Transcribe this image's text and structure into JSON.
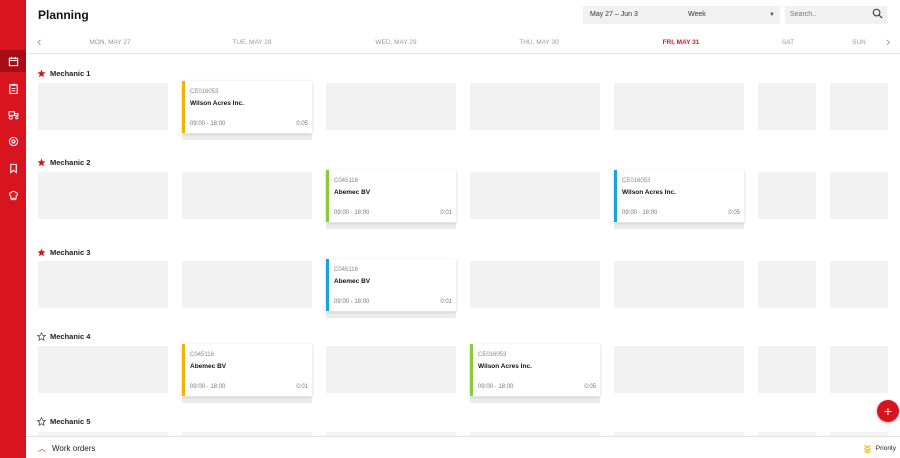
{
  "header": {
    "title": "Planning",
    "date_range": "May 27 – Jun 3",
    "view": "Week",
    "search_placeholder": "Search.."
  },
  "days": [
    {
      "label": "MON, MAY 27",
      "today": false
    },
    {
      "label": "TUE, MAY 28",
      "today": false
    },
    {
      "label": "WED, MAY 29",
      "today": false
    },
    {
      "label": "THU, MAY 30",
      "today": false
    },
    {
      "label": "FRI, MAY 31",
      "today": true
    },
    {
      "label": "SAT",
      "today": false
    },
    {
      "label": "SUN",
      "today": false
    }
  ],
  "mechanics": [
    {
      "name": "Mechanic 1",
      "starred": true
    },
    {
      "name": "Mechanic 2",
      "starred": true
    },
    {
      "name": "Mechanic 3",
      "starred": true
    },
    {
      "name": "Mechanic 4",
      "starred": false
    },
    {
      "name": "Mechanic 5",
      "starred": false
    }
  ],
  "jobs": [
    {
      "mechanic": 0,
      "day": 1,
      "code": "CE016053",
      "customer": "Wilson Acres Inc.",
      "time": "09:00 - 18:00",
      "duration": "0:05",
      "color": "#f0b400"
    },
    {
      "mechanic": 1,
      "day": 2,
      "code": "C045116",
      "customer": "Abemec BV",
      "time": "09:00 - 18:00",
      "duration": "0:01",
      "color": "#8dc63f"
    },
    {
      "mechanic": 1,
      "day": 4,
      "code": "CE016053",
      "customer": "Wilson Acres Inc.",
      "time": "09:00 - 18:00",
      "duration": "0:05",
      "color": "#1aa3d6"
    },
    {
      "mechanic": 2,
      "day": 2,
      "code": "C045116",
      "customer": "Abemec BV",
      "time": "09:00 - 18:00",
      "duration": "0:01",
      "color": "#1aa3d6"
    },
    {
      "mechanic": 3,
      "day": 1,
      "code": "C045116",
      "customer": "Abemec BV",
      "time": "09:00 - 18:00",
      "duration": "0:01",
      "color": "#f0b400"
    },
    {
      "mechanic": 3,
      "day": 3,
      "code": "CE016053",
      "customer": "Wilson Acres Inc.",
      "time": "09:00 - 18:00",
      "duration": "0:05",
      "color": "#8dc63f"
    }
  ],
  "sidebar": {
    "icons": [
      "calendar-icon",
      "clipboard-icon",
      "tractor-icon",
      "settings-icon",
      "bookmark-icon",
      "chef-icon"
    ]
  },
  "footer": {
    "work_orders": "Work orders",
    "priority": "Priority"
  },
  "fab": {
    "label": "+"
  },
  "colors": {
    "accent": "#d8141f",
    "accent_dark": "#a80d15"
  }
}
